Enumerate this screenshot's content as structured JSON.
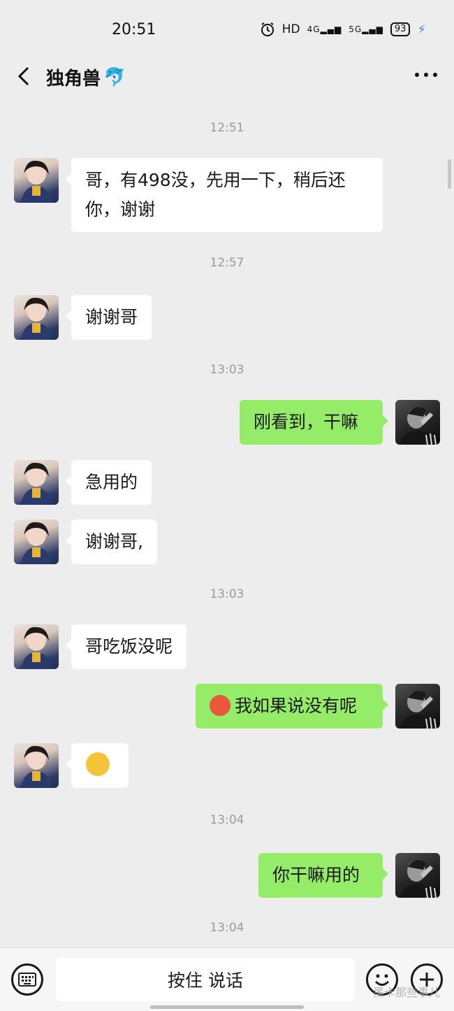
{
  "status_bar": {
    "time": "20:51",
    "icons": [
      "alarm-icon",
      "hd-icon",
      "signal-4g-icon",
      "signal-5g-icon",
      "battery-icon",
      "charging-icon"
    ],
    "hd_label": "HD",
    "net_4g": "4G",
    "net_5g": "5G",
    "battery": "93"
  },
  "header": {
    "title": "独角兽",
    "title_emoji": "🐬"
  },
  "messages": [
    {
      "type": "time",
      "text": "12:51"
    },
    {
      "type": "msg",
      "side": "left",
      "text": "哥，有498没，先用一下，稍后还你，谢谢"
    },
    {
      "type": "time",
      "text": "12:57"
    },
    {
      "type": "msg",
      "side": "left",
      "text": "谢谢哥"
    },
    {
      "type": "time",
      "text": "13:03"
    },
    {
      "type": "msg",
      "side": "right",
      "text": "刚看到，干嘛"
    },
    {
      "type": "msg",
      "side": "left",
      "text": "急用的"
    },
    {
      "type": "msg",
      "side": "left",
      "text": "谢谢哥,"
    },
    {
      "type": "time",
      "text": "13:03"
    },
    {
      "type": "msg",
      "side": "left",
      "text": "哥吃饭没呢"
    },
    {
      "type": "msg",
      "side": "right",
      "text": "我如果说没有呢",
      "emoji": "flushed-face-emoji"
    },
    {
      "type": "msg",
      "side": "left",
      "text": "",
      "emoji": "tears-of-joy-emoji"
    },
    {
      "type": "time",
      "text": "13:04"
    },
    {
      "type": "msg",
      "side": "right",
      "text": "你干嘛用的"
    },
    {
      "type": "time",
      "text": "13:04"
    }
  ],
  "input_bar": {
    "voice_label": "按住 说话",
    "watermark": "黑卡那些事儿"
  },
  "colors": {
    "background": "#ededed",
    "sent_bubble": "#95ec69",
    "received_bubble": "#ffffff"
  }
}
